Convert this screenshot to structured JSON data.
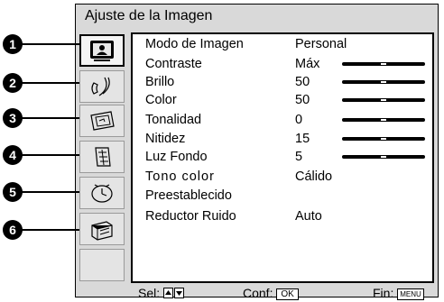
{
  "title": "Ajuste de la Imagen",
  "callouts": [
    "1",
    "2",
    "3",
    "4",
    "5",
    "6"
  ],
  "sidebar": {
    "tabs": [
      {
        "icon": "picture-icon",
        "active": true
      },
      {
        "icon": "sound-icon",
        "active": false
      },
      {
        "icon": "screen-icon",
        "active": false
      },
      {
        "icon": "features-icon",
        "active": false
      },
      {
        "icon": "timer-icon",
        "active": false
      },
      {
        "icon": "setup-icon",
        "active": false
      },
      {
        "icon": "empty",
        "active": false
      }
    ]
  },
  "settings": [
    {
      "label": "Modo de Imagen",
      "value": "Personal"
    },
    {
      "label": "Contraste",
      "value": "Máx",
      "level": 0.5
    },
    {
      "label": "Brillo",
      "value": "50",
      "level": 0.5
    },
    {
      "label": "Color",
      "value": "50",
      "level": 0.5
    },
    {
      "label": "Tonalidad",
      "value": "0",
      "level": 0.5
    },
    {
      "label": "Nitidez",
      "value": "15",
      "level": 0.5
    },
    {
      "label": "Luz Fondo",
      "value": "5",
      "level": 0.5
    },
    {
      "label": "Tono color",
      "value": "Cálido"
    },
    {
      "label": "Preestablecido",
      "value": ""
    },
    {
      "label": "Reductor Ruido",
      "value": "Auto"
    }
  ],
  "footer": {
    "select_label": "Sel:",
    "confirm_label": "Conf:",
    "confirm_key": "OK",
    "end_label": "Fin:",
    "end_key": "MENU"
  }
}
